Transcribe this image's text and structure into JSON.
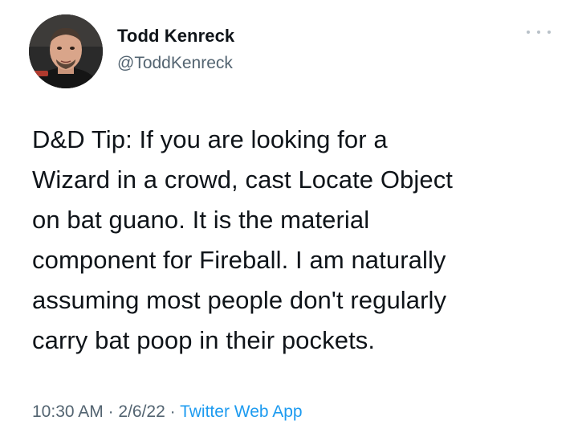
{
  "author": {
    "display_name": "Todd Kenreck",
    "handle": "@ToddKenreck",
    "avatar": "profile-photo"
  },
  "more_menu": {
    "icon": "more-dots-icon"
  },
  "tweet": {
    "text": "D&D Tip: If you are looking for a\nWizard in a crowd, cast Locate Object\non bat guano. It is the material\ncomponent for Fireball. I am naturally\nassuming most people don't regularly\ncarry bat poop in their pockets."
  },
  "meta": {
    "time": "10:30 AM",
    "separator": " · ",
    "date": "2/6/22",
    "source": "Twitter Web App"
  },
  "colors": {
    "text": "#0f1419",
    "secondary": "#536471",
    "link": "#1d9bf0"
  }
}
